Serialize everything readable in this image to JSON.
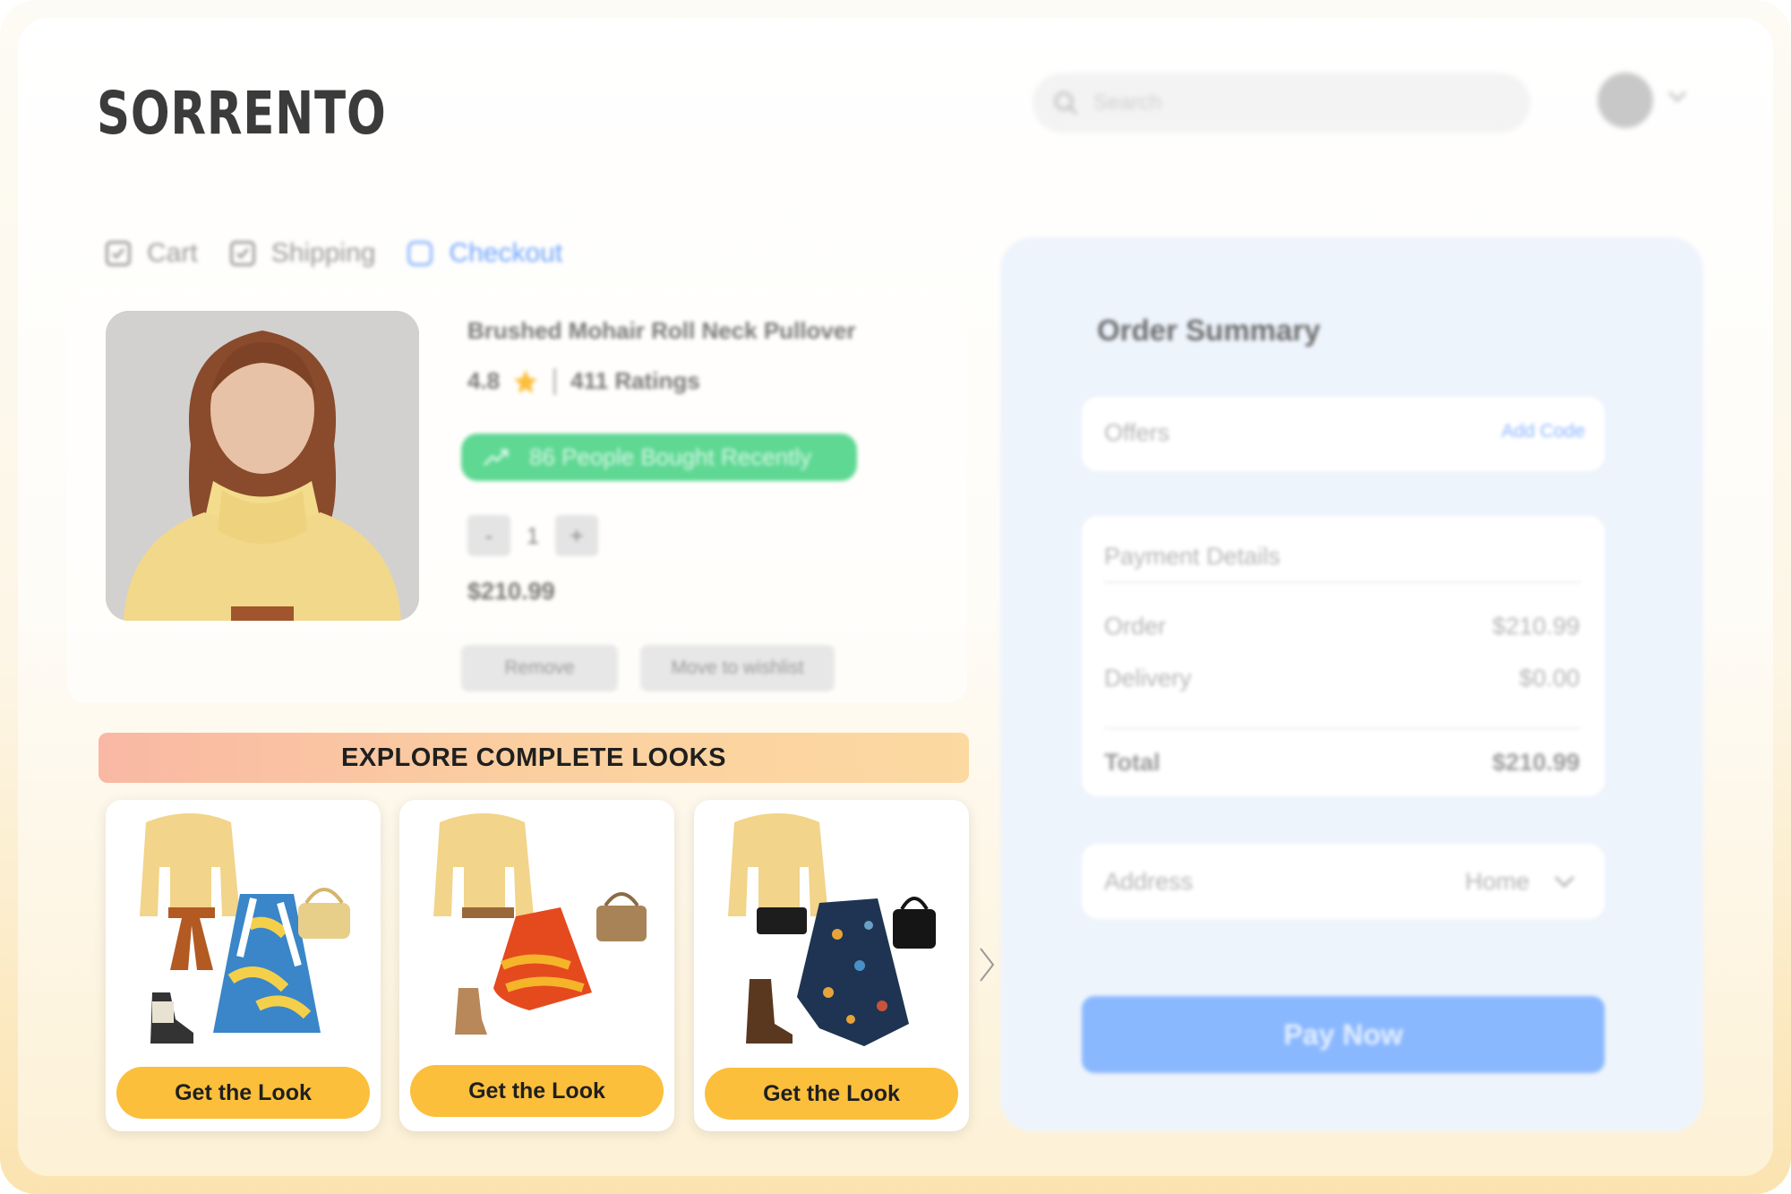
{
  "brand": {
    "logo": "SORRENTO"
  },
  "header": {
    "search_placeholder": "Search",
    "search_icon": "search-icon",
    "avatar_icon": "avatar",
    "chevron_icon": "chevron-down-icon"
  },
  "steps": [
    {
      "label": "Cart",
      "state": "done"
    },
    {
      "label": "Shipping",
      "state": "done"
    },
    {
      "label": "Checkout",
      "state": "active"
    }
  ],
  "product": {
    "title": "Brushed Mohair Roll Neck Pullover",
    "rating": "4.8",
    "ratings_count": "411 Ratings",
    "bought_recently": "86 People Bought Recently",
    "quantity": "1",
    "qty_minus": "-",
    "qty_plus": "+",
    "price": "$210.99",
    "remove_label": "Remove",
    "wishlist_label": "Move to wishlist"
  },
  "looks": {
    "banner": "EXPLORE COMPLETE LOOKS",
    "items": [
      {
        "button": "Get the Look"
      },
      {
        "button": "Get the Look"
      },
      {
        "button": "Get the Look"
      }
    ]
  },
  "summary": {
    "title": "Order Summary",
    "offers_label": "Offers",
    "add_code": "Add Code",
    "payment_title": "Payment Details",
    "order_label": "Order",
    "order_value": "$210.99",
    "delivery_label": "Delivery",
    "delivery_value": "$0.00",
    "total_label": "Total",
    "total_value": "$210.99",
    "address_label": "Address",
    "address_value": "Home",
    "pay_label": "Pay Now"
  },
  "colors": {
    "accent_blue": "#8ab8ff",
    "look_button": "#fbbf3c",
    "bought_badge": "#5fd893"
  }
}
